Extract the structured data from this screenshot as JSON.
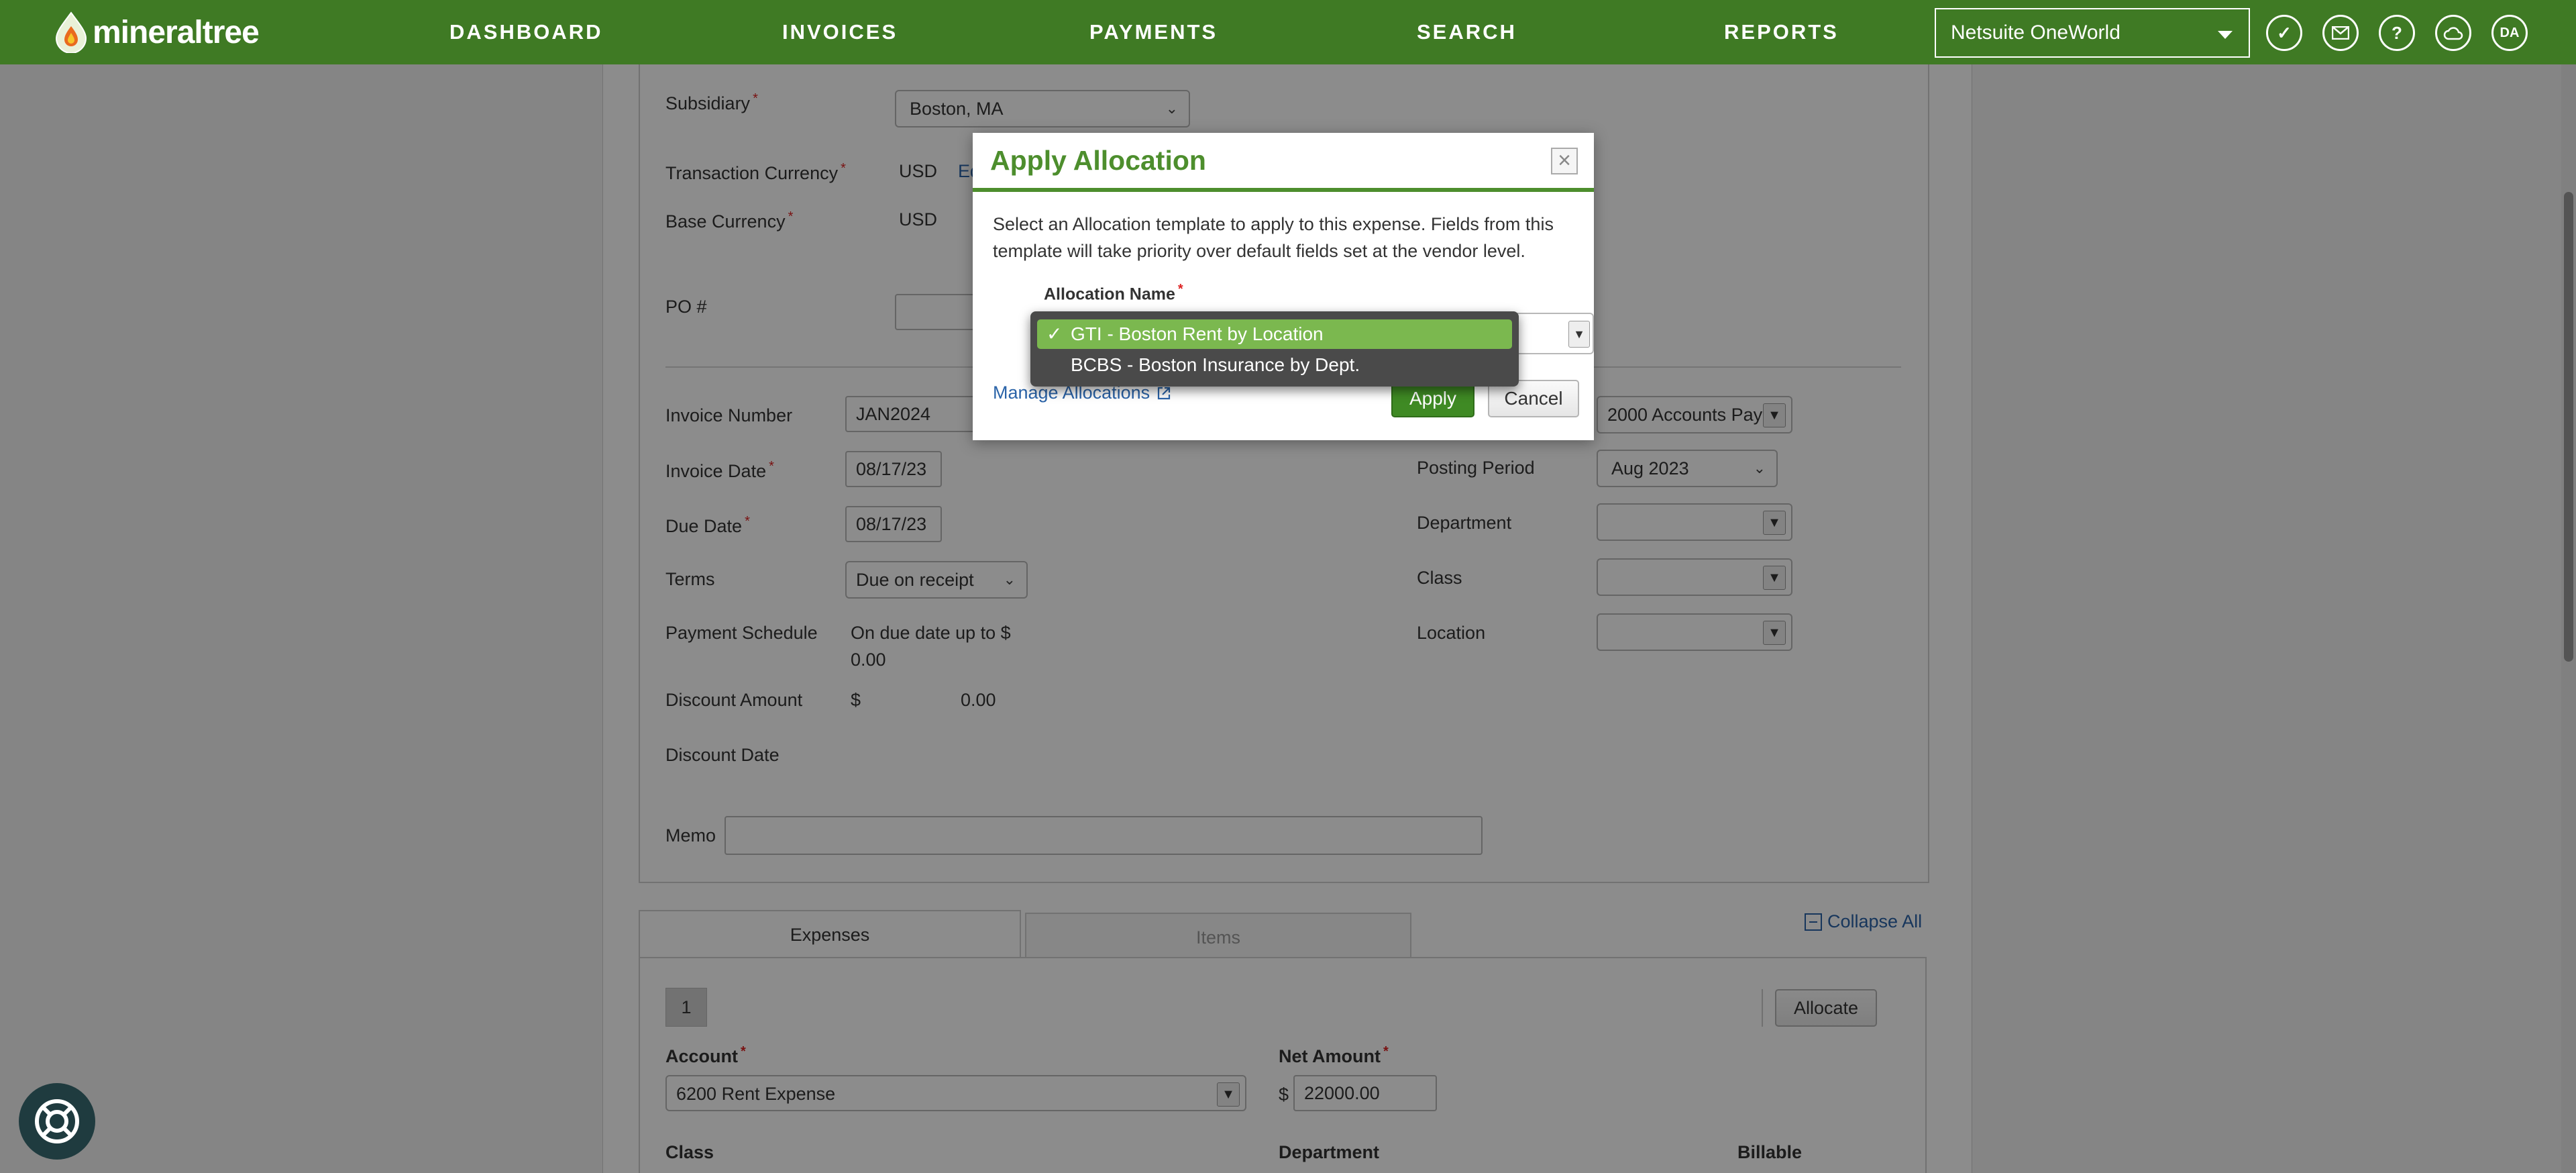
{
  "header": {
    "logo_text": "mineraltree",
    "nav": [
      "DASHBOARD",
      "INVOICES",
      "PAYMENTS",
      "SEARCH",
      "REPORTS"
    ],
    "org_select": "Netsuite OneWorld",
    "avatar_initials": "DA"
  },
  "form": {
    "subsidiary_label": "Subsidiary",
    "subsidiary_value": "Boston, MA",
    "txn_currency_label": "Transaction Currency",
    "txn_currency_value": "USD",
    "txn_currency_edit": "Ed",
    "base_currency_label": "Base Currency",
    "base_currency_value": "USD",
    "po_label": "PO #",
    "invoice_number_label": "Invoice Number",
    "invoice_number_value": "JAN2024",
    "invoice_date_label": "Invoice Date",
    "invoice_date_value": "08/17/23",
    "due_date_label": "Due Date",
    "due_date_value": "08/17/23",
    "terms_label": "Terms",
    "terms_value": "Due on receipt",
    "payment_schedule_label": "Payment Schedule",
    "payment_schedule_line1": "On due date up to $",
    "payment_schedule_line2": "0.00",
    "discount_amount_label": "Discount Amount",
    "discount_currency": "$",
    "discount_amount_value": "0.00",
    "discount_date_label": "Discount Date",
    "memo_label": "Memo",
    "ap_account_value": "2000 Accounts Pay",
    "posting_period_label": "Posting Period",
    "posting_period_value": "Aug 2023",
    "department_label": "Department",
    "class_label": "Class",
    "location_label": "Location"
  },
  "lines": {
    "tabs": [
      "Expenses",
      "Items"
    ],
    "collapse_all": "Collapse All",
    "row_number": "1",
    "allocate_button": "Allocate",
    "account_label": "Account",
    "account_value": "6200 Rent Expense",
    "net_amount_label": "Net Amount",
    "net_amount_currency": "$",
    "net_amount_value": "22000.00",
    "class_label": "Class",
    "department_label": "Department",
    "billable_label": "Billable"
  },
  "modal": {
    "title": "Apply Allocation",
    "description": "Select an Allocation template to apply to this expense. Fields from this template will take priority over default fields set at the vendor level.",
    "allocation_name_label": "Allocation Name",
    "manage_link": "Manage Allocations",
    "apply_button": "Apply",
    "cancel_button": "Cancel",
    "options": [
      {
        "label": "GTI - Boston Rent by Location",
        "selected": true
      },
      {
        "label": "BCBS - Boston Insurance by Dept.",
        "selected": false
      }
    ],
    "check_mark": "✓"
  },
  "colors": {
    "brand_green": "#4a8c2a",
    "accent_green": "#4d8e2d",
    "link_blue": "#2a63a8",
    "selected_option": "#7bb84f"
  }
}
